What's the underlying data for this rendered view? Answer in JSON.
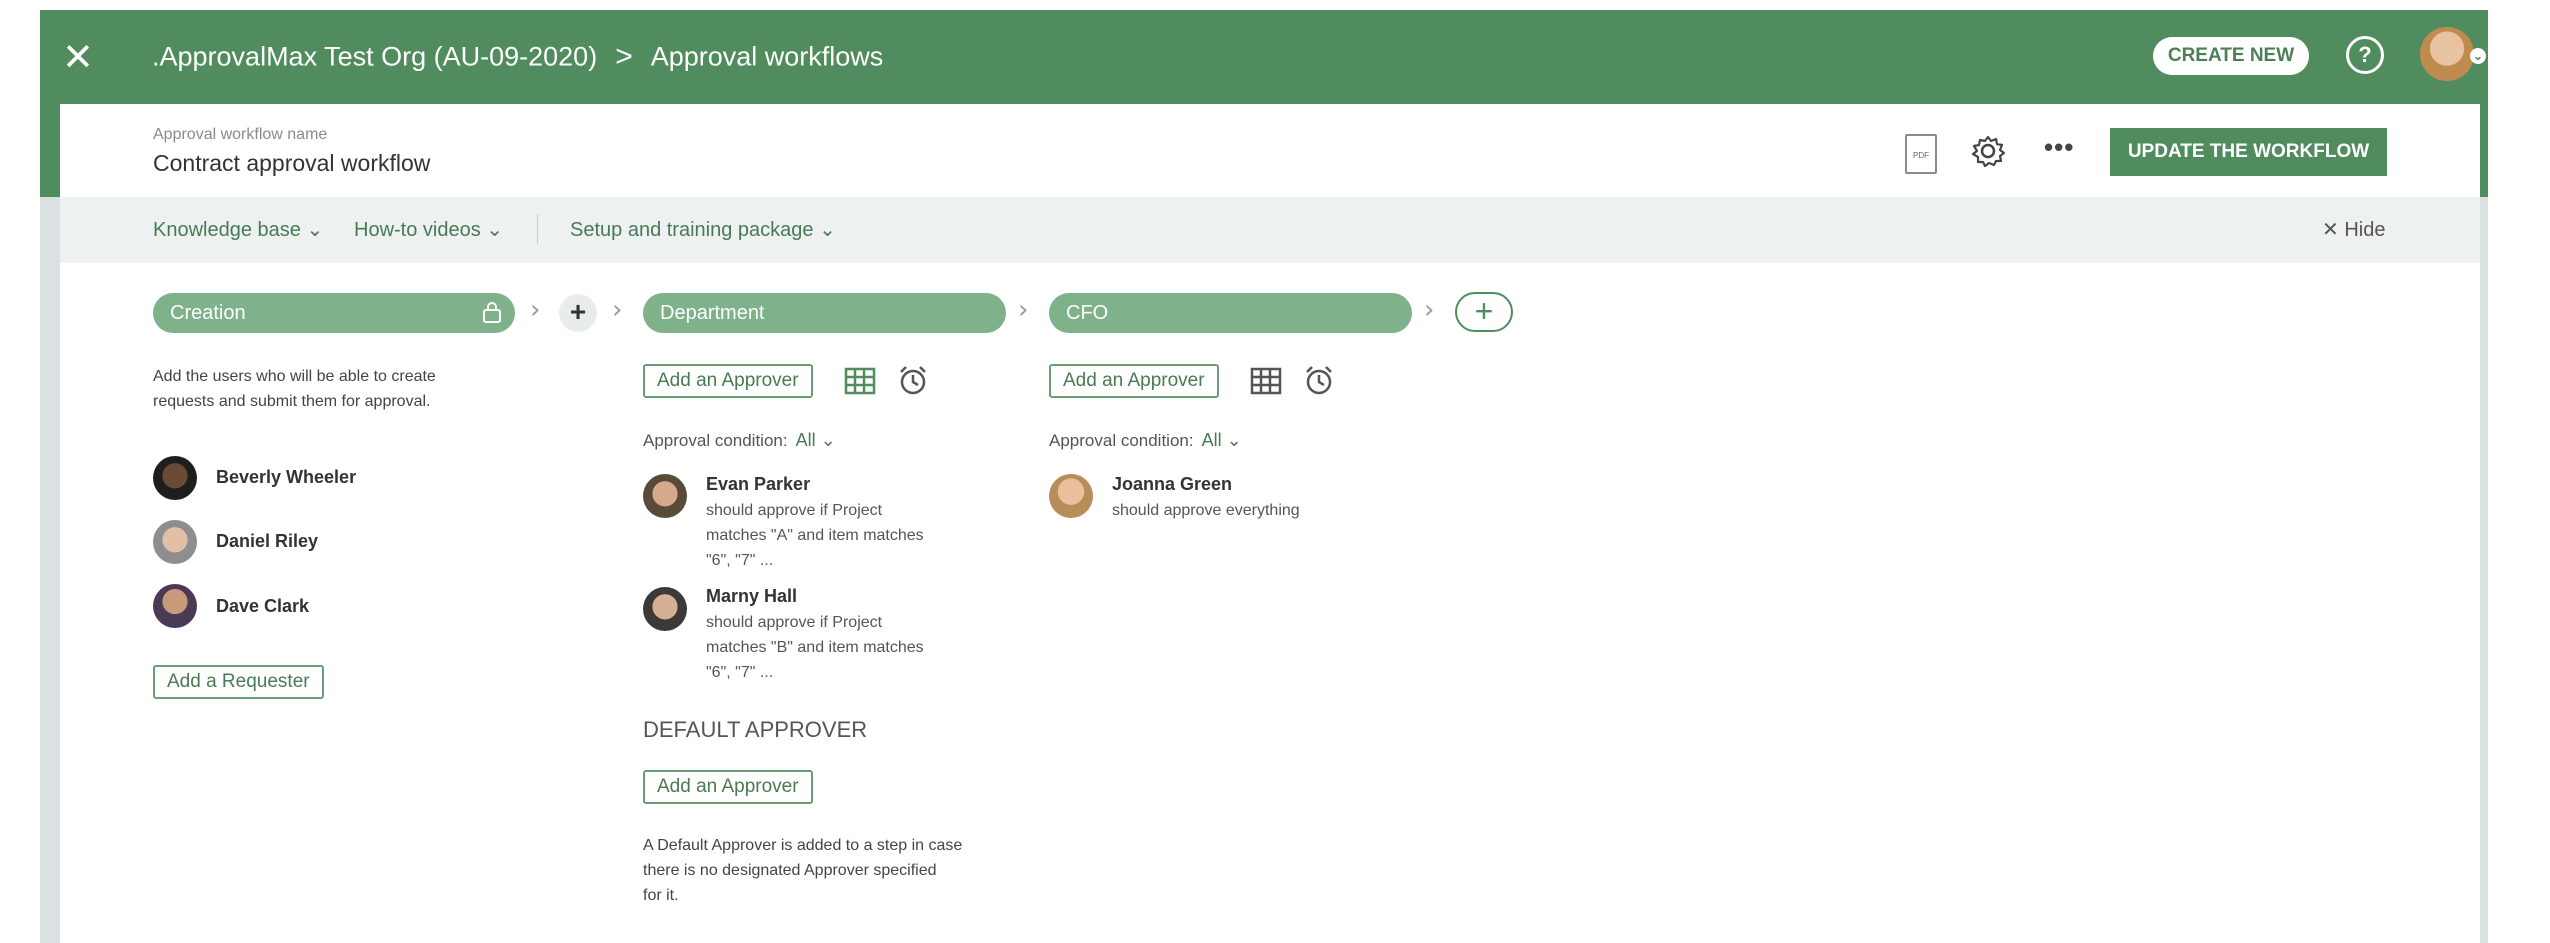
{
  "header": {
    "org_name": ".ApprovalMax Test Org (AU-09-2020)",
    "separator": ">",
    "section": "Approval workflows",
    "create_new": "CREATE NEW",
    "help": "?"
  },
  "workflow": {
    "name_label": "Approval workflow name",
    "name": "Contract approval workflow",
    "pdf_label": "PDF",
    "update_button": "UPDATE THE WORKFLOW"
  },
  "help_bar": {
    "items": [
      "Knowledge base ⌄",
      "How-to videos ⌄",
      "Setup and training package ⌄"
    ],
    "hide": "✕ Hide"
  },
  "steps": {
    "creation": {
      "label": "Creation",
      "description_lines": [
        "Add the users who will be able to create",
        "requests and submit them for approval."
      ],
      "requesters": [
        "Beverly Wheeler",
        "Daniel Riley",
        "Dave Clark"
      ],
      "add_requester": "Add a Requester"
    },
    "department": {
      "label": "Department",
      "add_approver": "Add an Approver",
      "condition_label": "Approval condition:",
      "condition_value": "All ⌄",
      "approvers": [
        {
          "name": "Evan Parker",
          "lines": [
            "should approve if Project",
            "matches \"A\" and item matches",
            "\"6\", \"7\" ..."
          ]
        },
        {
          "name": "Marny Hall",
          "lines": [
            "should approve if Project",
            "matches \"B\" and item matches",
            "\"6\", \"7\" ..."
          ]
        }
      ],
      "default_title": "DEFAULT APPROVER",
      "default_add": "Add an Approver",
      "default_desc": [
        "A Default Approver is added to a step in case",
        "there is no designated Approver specified",
        "for it."
      ]
    },
    "cfo": {
      "label": "CFO",
      "add_approver": "Add an Approver",
      "condition_label": "Approval condition:",
      "condition_value": "All ⌄",
      "approvers": [
        {
          "name": "Joanna Green",
          "lines": [
            "should approve everything"
          ]
        }
      ]
    }
  },
  "colors": {
    "brand_green": "#508c5e",
    "pill_green": "#7fb28a",
    "link_green": "#4a7a55"
  }
}
